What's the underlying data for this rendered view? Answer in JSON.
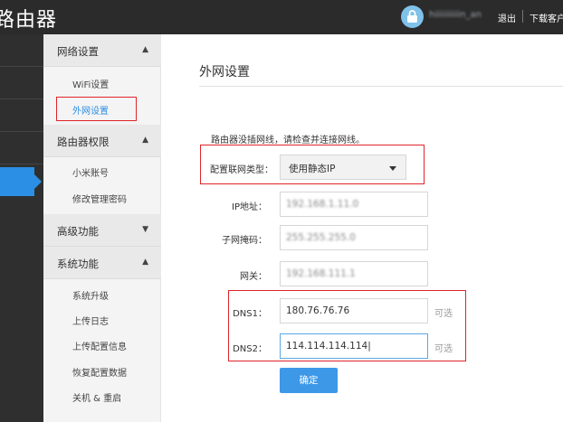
{
  "header": {
    "brand": "路由器",
    "username": "hiiiiiiiiiin_an",
    "logout": "退出",
    "download": "下载客户端"
  },
  "sidebar": {
    "sections": [
      {
        "title": "网络设置",
        "chevron": "up",
        "items": [
          "WiFi设置",
          "外网设置"
        ]
      },
      {
        "title": "路由器权限",
        "chevron": "up",
        "items": [
          "小米账号",
          "修改管理密码"
        ]
      },
      {
        "title": "高级功能",
        "chevron": "down",
        "items": []
      },
      {
        "title": "系统功能",
        "chevron": "up",
        "items": [
          "系统升级",
          "上传日志",
          "上传配置信息",
          "恢复配置数据",
          "关机 & 重启"
        ]
      }
    ],
    "active_item": "外网设置"
  },
  "main": {
    "title": "外网设置",
    "notice": "路由器没插网线，请检查并连接网线。",
    "conn_type_label": "配置联网类型：",
    "conn_type_value": "使用静态IP",
    "ip_label": "IP地址：",
    "ip_value": "192.168.1.11.0",
    "mask_label": "子网掩码：",
    "mask_value": "255.255.255.0",
    "gateway_label": "网关：",
    "gateway_value": "192.168.111.1",
    "dns1_label": "DNS1：",
    "dns1_value": "180.76.76.76",
    "dns2_label": "DNS2：",
    "dns2_value": "114.114.114.114",
    "optional": "可选",
    "confirm": "确定"
  },
  "colors": {
    "accent": "#2b8fe5",
    "highlight_box": "#e0242a",
    "topbar": "#2b2b2b"
  },
  "icons": {
    "account": "lock-icon"
  }
}
